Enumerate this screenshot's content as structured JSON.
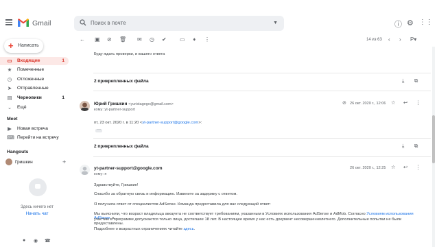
{
  "app": {
    "logo_text": "Gmail",
    "search_placeholder": "Поиск в почте",
    "compose_label": "Написать"
  },
  "sidebar": {
    "items": [
      {
        "label": "Входящие",
        "count": "1",
        "icon": "inbox-icon",
        "glyph": "▭"
      },
      {
        "label": "Помеченные",
        "count": "",
        "icon": "star-icon",
        "glyph": "★"
      },
      {
        "label": "Отложенные",
        "count": "",
        "icon": "clock-icon",
        "glyph": "◷"
      },
      {
        "label": "Отправленные",
        "count": "",
        "icon": "send-icon",
        "glyph": "➤"
      },
      {
        "label": "Черновики",
        "count": "1",
        "icon": "draft-icon",
        "glyph": "▤"
      },
      {
        "label": "Ещё",
        "count": "",
        "icon": "chevron-down-icon",
        "glyph": "⌄"
      }
    ],
    "meet_title": "Meet",
    "meet_items": [
      {
        "label": "Новая встреча",
        "icon": "video-icon",
        "glyph": "▶"
      },
      {
        "label": "Перейти на встречу",
        "icon": "keyboard-icon",
        "glyph": "⌨"
      }
    ],
    "hangouts_title": "Hangouts",
    "hangouts_user": "Гришкин",
    "hangouts_empty": "Здесь ничего нет",
    "hangouts_start": "Начать чат"
  },
  "toolbar": {
    "pager": "14 из 63"
  },
  "thread": {
    "quoted_line": "Буду ждать проверки, и вашего ответа",
    "attachments_label": "2 прикрепленных файла",
    "msg1": {
      "sender_name": "Юрий Гришкин",
      "sender_email": "<yuristagego@gmail.com>",
      "to": "кому: yt-partner-support",
      "date": "26 окт. 2020 г., 12:06",
      "quote_intro": "пт, 23 окт. 2020 г. в 11:20 <",
      "quote_link": "yt-partner-support@google.com",
      "quote_end": ">:"
    },
    "attachments2_label": "2 прикрепленных файла",
    "msg2": {
      "sender_name": "yt-partner-support@google.com",
      "to": "кому: я",
      "date": "26 окт. 2020 г., 12:25",
      "greeting": "Здравствуйте, Гришкин!",
      "p1": "Спасибо за обратную связь и информацию. Извините за задержку с ответом.",
      "p2": "Я получила ответ от специалистов AdSense. Команда предоставила для вас следующий ответ:",
      "p3a": "Мы выяснили, что возраст владельца аккаунта не соответствует требованиям, указанным в Условиях использования AdSense и AdMob. Согласно",
      "p3link": "Условиям использования AdSense",
      "p3b": ", к",
      "p3c": "участию в программе допускаются только лица, достигшие 18 лет. В настоящее время у нас есть документ несовершеннолетнего. Дополнительные попытки не были предоставлены.",
      "p4a": "Подробнее о возрастных ограничениях читайте",
      "p4link": "здесь",
      "p4b": "."
    }
  },
  "colors": {
    "accent": "#1a73e8",
    "inbox_active": "#d93025",
    "inbox_bg": "#fce8e6"
  }
}
